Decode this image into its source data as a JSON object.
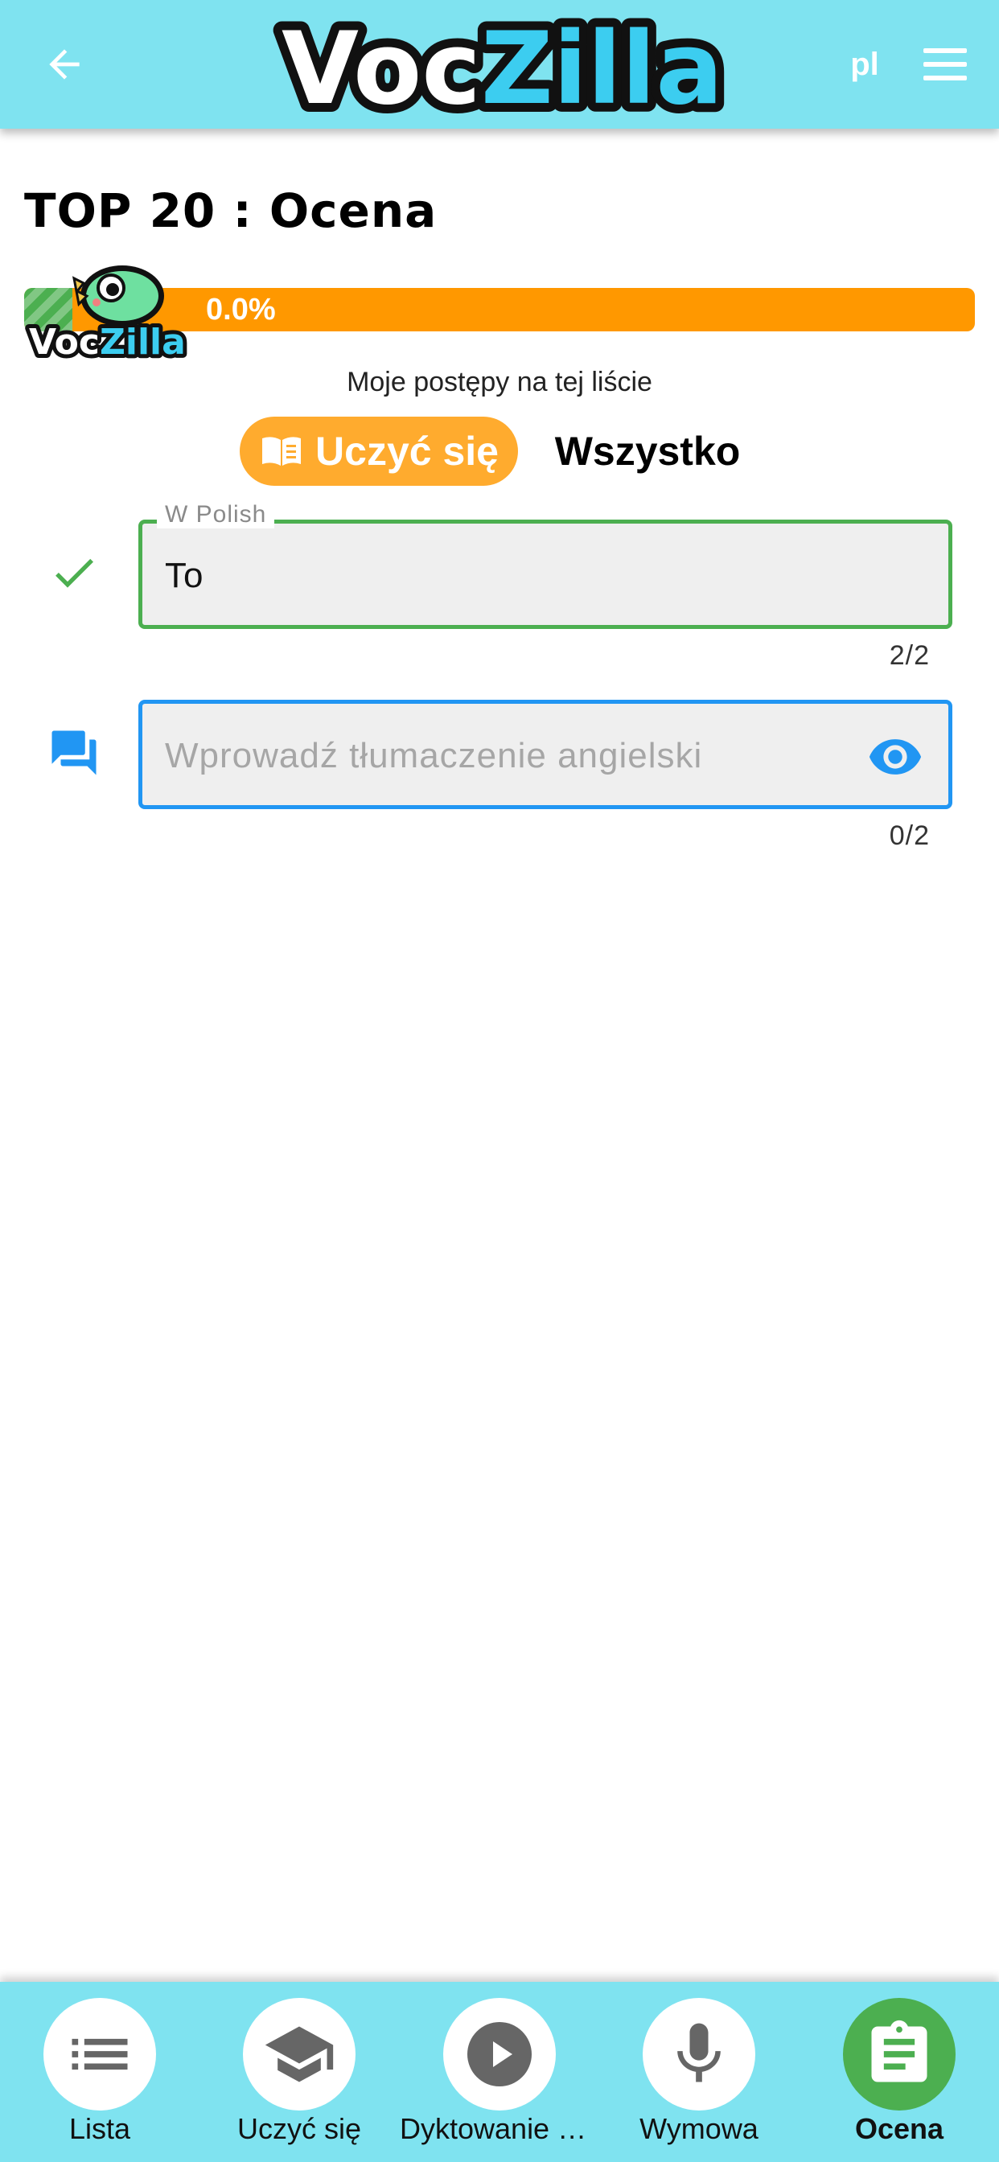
{
  "header": {
    "logo_text_1": "Voc",
    "logo_text_2": "Zilla",
    "language": "pl"
  },
  "page": {
    "title": "TOP 20 : Ocena",
    "progress_percent": 0.0,
    "progress_label": "0.0%",
    "progress_caption": "Moje postępy na tej liście",
    "mascot_text_1": "Voc",
    "mascot_text_2": "Zilla"
  },
  "toggle": {
    "learn_label": "Uczyć się",
    "all_label": "Wszystko"
  },
  "fields": [
    {
      "label": "W Polish",
      "value": "To",
      "counter": "2/2"
    },
    {
      "placeholder": "Wprowadź tłumaczenie angielski",
      "counter": "0/2"
    }
  ],
  "nav": {
    "items": [
      {
        "label": "Lista",
        "icon": "list-icon"
      },
      {
        "label": "Uczyć się",
        "icon": "graduation-cap-icon"
      },
      {
        "label": "Dyktowanie gł…",
        "icon": "play-icon"
      },
      {
        "label": "Wymowa",
        "icon": "microphone-icon"
      },
      {
        "label": "Ocena",
        "icon": "clipboard-icon",
        "active": true
      }
    ]
  },
  "colors": {
    "header_bg": "#7fe3f0",
    "progress": "#ff9800",
    "learn_toggle": "#ffab2e",
    "field_valid": "#4caf50",
    "field_focus": "#2196f3",
    "active_nav": "#4caf50"
  }
}
